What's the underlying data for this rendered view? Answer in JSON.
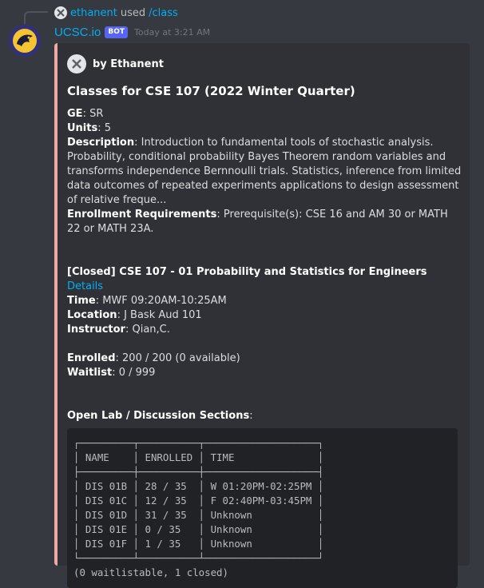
{
  "reply": {
    "user": "ethanent",
    "action": "used",
    "command": "/class"
  },
  "message": {
    "bot_name": "UCSC.io",
    "bot_tag": "BOT",
    "timestamp": "Today at 3:21 AM"
  },
  "embed": {
    "author": "by Ethanent",
    "title": "Classes for CSE 107 (2022 Winter Quarter)",
    "fields": [
      {
        "label": "GE",
        "value": ": SR"
      },
      {
        "label": "Units",
        "value": ": 5"
      },
      {
        "label": "Description",
        "value": ": Introduction to fundamental tools of stochastic analysis. Probability, conditional probability Bayes Theorem random variables and transforms independence Bernnoulli trials. Statistics, inference from limited data outcomes of repeated experiments applications to design assessment of relative freque..."
      },
      {
        "label": "Enrollment Requirements",
        "value": ": Prerequisite(s): CSE 16 and AM 30 or MATH 22 or MATH 23A."
      }
    ],
    "section": {
      "heading": "[Closed] CSE 107 - 01 Probability and Statistics for Engineers",
      "details_link": "Details",
      "time_label": "Time",
      "time_value": ": MWF 09:20AM-10:25AM",
      "location_label": "Location",
      "location_value": ": J Bask Aud 101",
      "instructor_label": "Instructor",
      "instructor_value": ": Qian,C.",
      "enrolled_label": "Enrolled",
      "enrolled_value": ": 200 / 200 (0 available)",
      "waitlist_label": "Waitlist",
      "waitlist_value": ": 0 / 999"
    },
    "labs_heading": "Open Lab / Discussion Sections",
    "labs_colon": ":",
    "labs_table": {
      "headers": [
        "NAME",
        "ENROLLED",
        "TIME"
      ],
      "rows": [
        [
          "DIS 01B",
          "28 / 35",
          "W 01:20PM-02:25PM"
        ],
        [
          "DIS 01C",
          "12 / 35",
          "F 02:40PM-03:45PM"
        ],
        [
          "DIS 01D",
          "31 / 35",
          "Unknown"
        ],
        [
          "DIS 01E",
          "0 / 35",
          "Unknown"
        ],
        [
          "DIS 01F",
          "1 / 35",
          "Unknown"
        ]
      ],
      "footer": "(0 waitlistable, 1 closed)"
    }
  },
  "colors": {
    "accent": "#f0a8a6",
    "link": "#00aff4",
    "bot_tag": "#5865f2"
  }
}
